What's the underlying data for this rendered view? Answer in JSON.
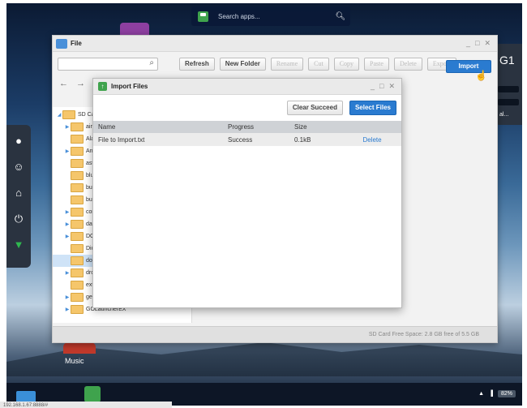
{
  "search": {
    "placeholder": "Search apps..."
  },
  "right_panel": {
    "title": "G1",
    "label": "al..."
  },
  "desktop": {
    "music_label": "Music"
  },
  "statusbar": {
    "ip": "192.168.1.67:8888/#",
    "battery": "82%"
  },
  "file_window": {
    "title": "File",
    "toolbar": {
      "refresh": "Refresh",
      "new_folder": "New Folder",
      "rename": "Rename",
      "cut": "Cut",
      "copy": "Copy",
      "paste": "Paste",
      "delete": "Delete",
      "export": "Export",
      "import": "Import"
    },
    "tree": [
      {
        "label": "SD Ca",
        "arrow": "◢"
      },
      {
        "label": "airc",
        "arrow": "▶"
      },
      {
        "label": "Ala",
        "arrow": ""
      },
      {
        "label": "An",
        "arrow": "▶"
      },
      {
        "label": "ast",
        "arrow": ""
      },
      {
        "label": "blu",
        "arrow": ""
      },
      {
        "label": "bur",
        "arrow": ""
      },
      {
        "label": "bur",
        "arrow": ""
      },
      {
        "label": "cor",
        "arrow": "▶"
      },
      {
        "label": "dat",
        "arrow": "▶"
      },
      {
        "label": "DCI",
        "arrow": "▶"
      },
      {
        "label": "Dic",
        "arrow": ""
      },
      {
        "label": "dov",
        "arrow": "",
        "selected": true
      },
      {
        "label": "dro",
        "arrow": "▶"
      },
      {
        "label": "ext",
        "arrow": ""
      },
      {
        "label": "get",
        "arrow": "▶"
      },
      {
        "label": "GOLauncherEX",
        "arrow": "▶"
      }
    ],
    "status": "SD Card Free Space: 2.8 GB free of 5.5 GB"
  },
  "import_dialog": {
    "title": "Import Files",
    "clear_succeed": "Clear Succeed",
    "select_files": "Select Files",
    "columns": [
      "Name",
      "Progress",
      "Size",
      ""
    ],
    "rows": [
      {
        "name": "File to Import.txt",
        "progress": "Success",
        "size": "0.1kB",
        "action": "Delete"
      }
    ]
  },
  "colors": {
    "accent": "#2a7bd0",
    "folder": "#f5c66b"
  }
}
